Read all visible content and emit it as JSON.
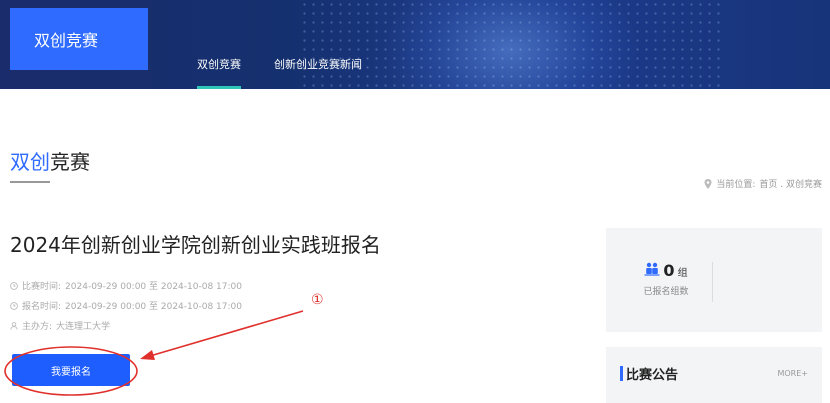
{
  "header": {
    "logo_text": "双创竞赛",
    "nav": [
      {
        "label": "双创竞赛",
        "active": true
      },
      {
        "label": "创新创业竞赛新闻",
        "active": false
      }
    ]
  },
  "section": {
    "title_highlight": "双创",
    "title_rest": "竞赛"
  },
  "breadcrumb": {
    "prefix": "当前位置:",
    "path": "首页 . 双创竞赛"
  },
  "competition": {
    "title": "2024年创新创业学院创新创业实践班报名",
    "contest_time_label": "比赛时间:",
    "contest_time": "2024-09-29 00:00 至 2024-10-08 17:00",
    "signup_time_label": "报名时间:",
    "signup_time": "2024-09-29 00:00 至 2024-10-08 17:00",
    "organizer_label": "主办方:",
    "organizer": "大连理工大学",
    "signup_button": "我要报名"
  },
  "stats": {
    "count": "0",
    "unit": "组",
    "label": "已报名组数"
  },
  "notice": {
    "title": "比赛公告",
    "more": "MORE+"
  },
  "annotation": {
    "marker": "①",
    "color": "#e0302b"
  },
  "colors": {
    "accent": "#2f6bff",
    "button": "#1e5eff",
    "nav_active": "#2ec4b6"
  },
  "icons": [
    "pin-icon",
    "clock-icon",
    "user-icon",
    "users-icon"
  ]
}
